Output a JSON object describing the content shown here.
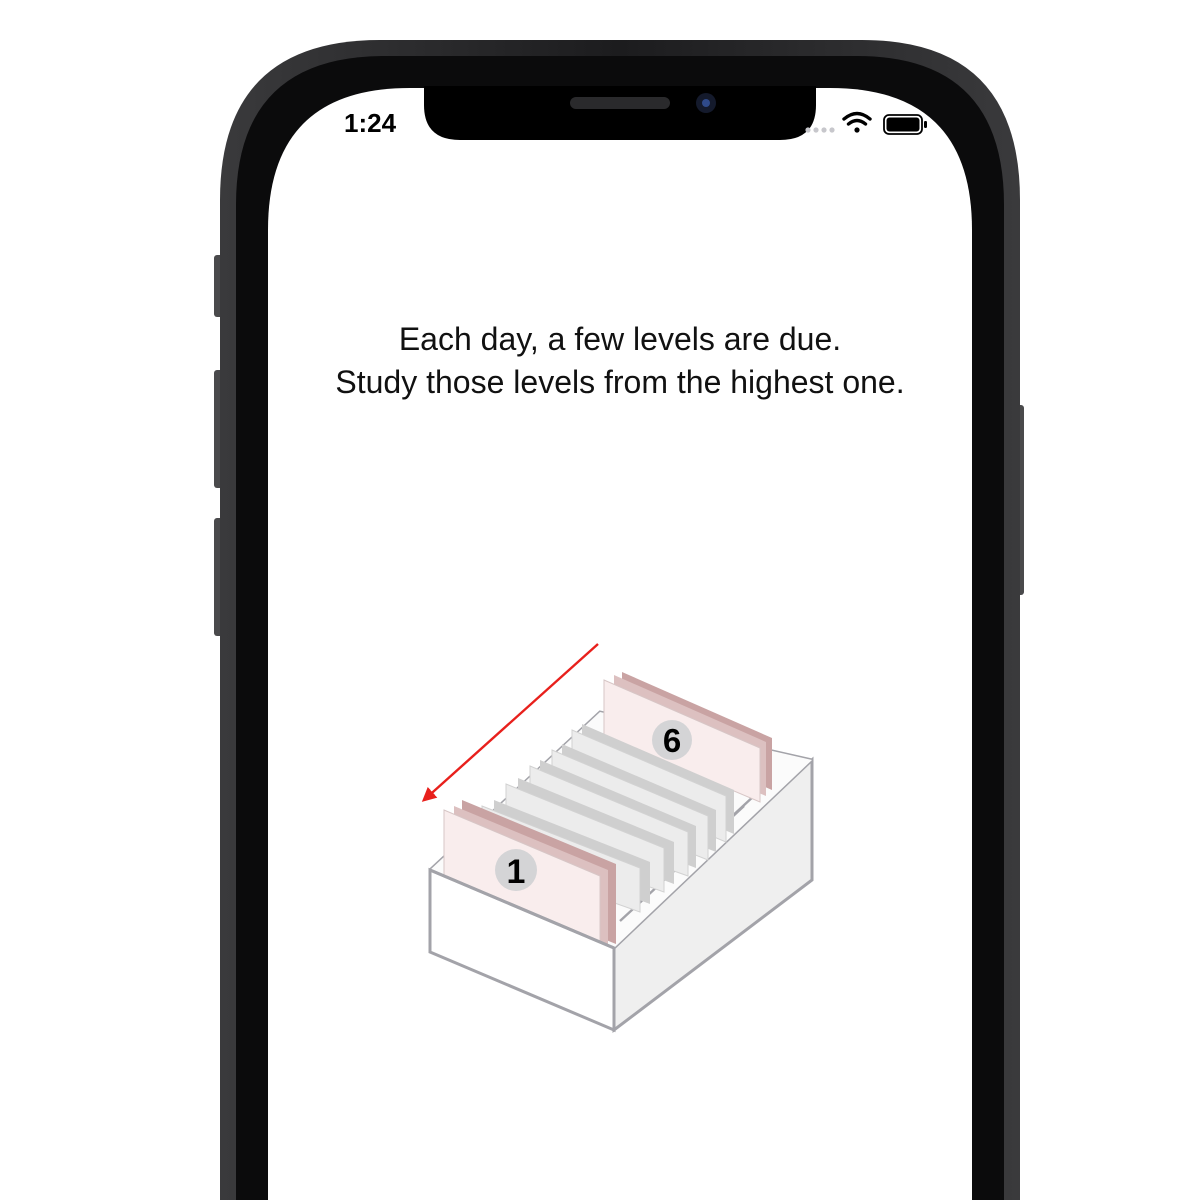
{
  "status_bar": {
    "time": "1:24",
    "icons": [
      "signal-dots-icon",
      "wifi-icon",
      "battery-icon"
    ]
  },
  "instructions": {
    "line1": "Each day, a few levels are due.",
    "line2": "Study those levels from the highest one."
  },
  "card_box": {
    "front_level_label": "1",
    "back_level_label": "6",
    "arrow_direction": "from back (level 6) to front (level 1)"
  },
  "colors": {
    "accent_arrow": "#e8201c",
    "highlight_card": "#f9eded",
    "highlight_card_edge": "#c9a3a3",
    "neutral_card": "#eeeeee",
    "box_stroke": "#a3a3a9",
    "device_frame": "#1c1c1e"
  }
}
